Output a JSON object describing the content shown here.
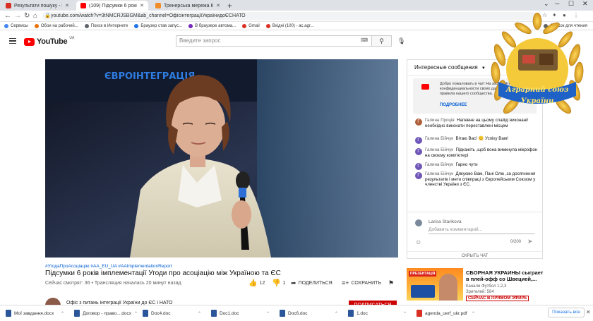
{
  "browser": {
    "tabs": [
      {
        "label": "Результати пошуку - larisa.starikov...",
        "color": "#d93025",
        "active": false
      },
      {
        "label": "(109) Підсумки 6 років імп...",
        "color": "#ff0000",
        "active": true
      },
      {
        "label": "Тренерська мережа К2К",
        "color": "#f28c28",
        "active": false
      }
    ],
    "new_tab": "+",
    "url": "youtube.com/watch?v=3tNMCRJSBGM&ab_channel=ОфісінтеграціїУкраїнидоЄСНАТО",
    "bookmarks": [
      {
        "label": "Сервисы",
        "color": "#4285f4"
      },
      {
        "label": "Обои на рабочий...",
        "color": "#e8710a"
      },
      {
        "label": "Поиск в Интернете",
        "color": "#5f6368"
      },
      {
        "label": "Браузер став запус...",
        "color": "#1a73e8"
      },
      {
        "label": "В браузере автома...",
        "color": "#7627bb"
      },
      {
        "label": "Gmail",
        "color": "#d93025"
      },
      {
        "label": "Вхідні (100) - ac.agr...",
        "color": "#d93025"
      },
      {
        "label": "Список для чтения",
        "color": "#5f6368"
      }
    ]
  },
  "youtube": {
    "logo_text": "YouTube",
    "region": "UA",
    "search_placeholder": "Введите запрос",
    "video_banner": "ЄВРОІНТЕГРАЦІЯ",
    "hashtags": "#УгодаПроАсоціацію #AA_EU_UA #AAImplementationReport",
    "title": "Підсумки 6 років імплементації Угоди про асоціацію між Україною та ЄС",
    "views_line": "Сейчас смотрят: 36 • Трансляция началась 20 минут назад",
    "likes": "12",
    "dislikes": "1",
    "share_label": "ПОДЕЛИТЬСЯ",
    "save_label": "СОХРАНИТЬ",
    "channel_name": "Офіс з питань інтеграції України до ЄС і НАТО",
    "subscribe_label": "ПОДПИСАТЬСЯ"
  },
  "chat": {
    "header": "Интересные сообщения",
    "notice_text": "Добро пожаловать в чат! На забывайте о конфиденциальности своих данных и соблюдайте правила нашего сообщества.",
    "notice_more": "ПОДРОБНЕЕ",
    "messages": [
      {
        "initial": "Г",
        "color": "#b05e3a",
        "author": "Галина Проців",
        "text": "Напевне на цьому слайді виконані/ необхідно виконати переставлені місцем"
      },
      {
        "initial": "Г",
        "color": "#6e56b8",
        "author": "Галина Бійчук",
        "text": "Вітаю Вас! 😊 Успіху Вам!"
      },
      {
        "initial": "Г",
        "color": "#6e56b8",
        "author": "Галина Бійчук",
        "text": "Підкажіть ,щоб вона вимкнула мікрофон на своєму комп'ютері"
      },
      {
        "initial": "Г",
        "color": "#6e56b8",
        "author": "Галина Бійчук",
        "text": "Гарно чути"
      },
      {
        "initial": "Г",
        "color": "#6e56b8",
        "author": "Галина Бійчук",
        "text": "Дякуємо Вам, Пані Олю ,за досягнення результатів і мети співпраці з Європейським Союзом у членстві України з ЄС."
      }
    ],
    "self_name": "Larisa Starikova",
    "comment_placeholder": "Добавить комментарий...",
    "counter": "0/200",
    "hide_label": "СКРЫТЬ ЧАТ"
  },
  "recommendation": {
    "thumb_text": "ПРЕЗЕНТАЦІЯ",
    "title": "СБОРНАЯ УКРАИНЫ сыграет в плей-офф со Швецией,...",
    "channel": "Канали Футбол 1,2,3",
    "viewers": "Зрителей: 584",
    "live": "СЕЙЧАС В ПРЯМОМ ЭФИРЕ"
  },
  "downloads": {
    "items": [
      {
        "label": "Мої завдання.docx",
        "color": "#2b579a"
      },
      {
        "label": "Договор - право....docx",
        "color": "#2b579a"
      },
      {
        "label": "Doc4.doc",
        "color": "#2b579a"
      },
      {
        "label": "Doc1.doc",
        "color": "#2b579a"
      },
      {
        "label": "Doc6.doc",
        "color": "#2b579a"
      },
      {
        "label": "1.doc",
        "color": "#2b579a"
      },
      {
        "label": "agenda_uerf_ukr.pdf",
        "color": "#d93025"
      }
    ],
    "show_all": "Показать все"
  },
  "logo": {
    "top_text": "Аграрний союз",
    "bottom_text": "України"
  }
}
